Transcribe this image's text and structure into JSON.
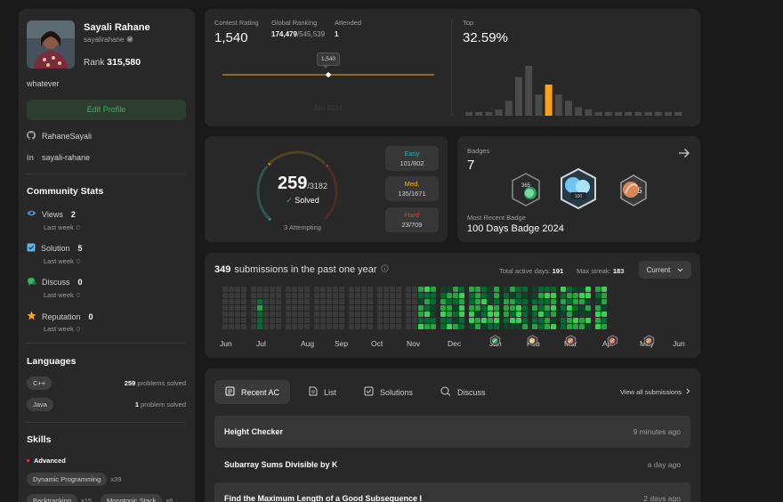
{
  "profile": {
    "name": "Sayali Rahane",
    "handle": "sayalirahane",
    "rank_label": "Rank",
    "rank_value": "315,580",
    "bio": "whatever",
    "edit_label": "Edit Profile",
    "github": "RahaneSayali",
    "linkedin": "sayali-rahane"
  },
  "community": {
    "title": "Community Stats",
    "items": [
      {
        "label": "Views",
        "value": "2",
        "sub": "Last week",
        "delta": "0",
        "icon": "eye-icon",
        "color": "#3b9bdc"
      },
      {
        "label": "Solution",
        "value": "5",
        "sub": "Last week",
        "delta": "0",
        "icon": "solution-check-icon",
        "color": "#5bb7e8"
      },
      {
        "label": "Discuss",
        "value": "0",
        "sub": "Last week",
        "delta": "0",
        "icon": "discuss-bubble-icon",
        "color": "#2cbb5d"
      },
      {
        "label": "Reputation",
        "value": "0",
        "sub": "Last week",
        "delta": "0",
        "icon": "star-icon",
        "color": "#ffa116"
      }
    ]
  },
  "languages": {
    "title": "Languages",
    "items": [
      {
        "name": "C++",
        "count": "259",
        "suffix": "problems solved"
      },
      {
        "name": "Java",
        "count": "1",
        "suffix": "problem solved"
      }
    ]
  },
  "skills": {
    "title": "Skills",
    "level": "Advanced",
    "items": [
      {
        "name": "Dynamic Programming",
        "count": "x39"
      },
      {
        "name": "Backtracking",
        "count": "x15"
      },
      {
        "name": "Monotonic Stack",
        "count": "x6"
      }
    ]
  },
  "contest": {
    "rating_label": "Contest Rating",
    "rating": "1,540",
    "global_label": "Global Ranking",
    "global_rank": "174,479",
    "global_total": "/545,539",
    "attended_label": "Attended",
    "attended": "1",
    "tooltip": "1,540",
    "axis_label": "Jun 2024",
    "top_label": "Top",
    "top_value": "32.59%",
    "histogram": [
      0.06,
      0.06,
      0.06,
      0.1,
      0.24,
      0.62,
      0.8,
      0.34,
      0.5,
      0.34,
      0.24,
      0.14,
      0.1,
      0.06,
      0.06,
      0.06,
      0.06,
      0.06,
      0.06,
      0.06,
      0.06,
      0.06
    ],
    "highlight_index": 8,
    "highlight_color": "#ffa116",
    "bar_color": "#4a4a4a"
  },
  "solved": {
    "count": "259",
    "total": "/3182",
    "label": "Solved",
    "attempting": "3 Attempting",
    "easy_label": "Easy",
    "easy": "101/802",
    "easy_color": "#1cbaba",
    "med_label": "Med.",
    "med": "135/1671",
    "med_color": "#ffb700",
    "hard_label": "Hard",
    "hard": "23/709",
    "hard_color": "#f63737"
  },
  "badges": {
    "label": "Badges",
    "count": "7",
    "recent_label": "Most Recent Badge",
    "recent_name": "100 Days Badge 2024",
    "icons": [
      "365-days-badge-icon",
      "100-days-badge-icon",
      "may-monthly-badge-icon"
    ]
  },
  "heatmap": {
    "count": "349",
    "title": "submissions in the past one year",
    "active_label": "Total active days:",
    "active_days": "191",
    "streak_label": "Max streak:",
    "max_streak": "183",
    "period": "Current",
    "months": [
      "Jun",
      "Jul",
      "Aug",
      "Sep",
      "Oct",
      "Nov",
      "Dec",
      "Jan",
      "Feb",
      "Mar",
      "Apr",
      "May",
      "Jun"
    ],
    "month_badge_icons": [
      "jan-badge-icon",
      "feb-badge-icon",
      "mar-badge-icon",
      "apr-badge-icon",
      "may-badge-icon"
    ],
    "colors": [
      "#3a3a3a",
      "#0e4429",
      "#006d32",
      "#26a641",
      "#39d353"
    ]
  },
  "submissions": {
    "tabs": [
      {
        "label": "Recent AC",
        "icon": "recent-ac-icon"
      },
      {
        "label": "List",
        "icon": "list-icon"
      },
      {
        "label": "Solutions",
        "icon": "solutions-icon"
      },
      {
        "label": "Discuss",
        "icon": "discuss-icon"
      }
    ],
    "view_all": "View all submissions",
    "rows": [
      {
        "title": "Height Checker",
        "ago": "9 minutes ago"
      },
      {
        "title": "Subarray Sums Divisible by K",
        "ago": "a day ago"
      },
      {
        "title": "Find the Maximum Length of a Good Subsequence I",
        "ago": "2 days ago"
      }
    ]
  }
}
